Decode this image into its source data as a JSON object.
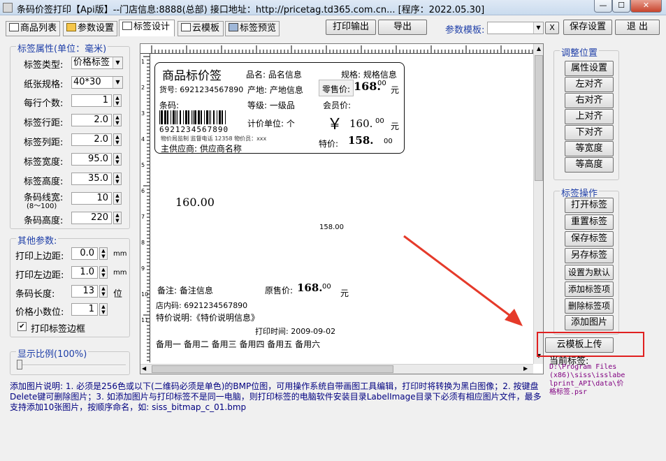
{
  "window": {
    "title": "条码价签打印【Api版】--门店信息:8888(总部) 接口地址：http://pricetag.td365.com.cn... [程序：2022.05.30]",
    "close_label": "✕",
    "min_label": "—",
    "max_label": "☐"
  },
  "tabs": [
    {
      "label": "商品列表"
    },
    {
      "label": "参数设置"
    },
    {
      "label": "标签设计"
    },
    {
      "label": "云模板"
    },
    {
      "label": "标签预览"
    }
  ],
  "toolbar": {
    "print_label": "打印输出",
    "export_label": "导出",
    "template_label": "参数模板:",
    "template_value": "",
    "clear_label": "X",
    "save_label": "保存设置",
    "exit_label": "退 出"
  },
  "label_props": {
    "title": "标签属性(单位：毫米)",
    "type_label": "标签类型:",
    "type_value": "价格标签",
    "size_label": "纸张规格:",
    "size_value": "40*30",
    "per_row_label": "每行个数:",
    "per_row_value": "1",
    "row_gap_label": "标签行距:",
    "row_gap_value": "2.0",
    "col_gap_label": "标签列距:",
    "col_gap_value": "2.0",
    "width_label": "标签宽度:",
    "width_value": "95.0",
    "height_label": "标签高度:",
    "height_value": "35.0",
    "line_width_label": "条码线宽:",
    "line_width_sub": "(8～100)",
    "line_width_value": "10",
    "barcode_height_label": "条码高度:",
    "barcode_height_value": "220"
  },
  "other_params": {
    "title": "其他参数:",
    "top_margin_label": "打印上边距:",
    "top_margin_value": "0.0",
    "top_margin_unit": "mm",
    "left_margin_label": "打印左边距:",
    "left_margin_value": "1.0",
    "left_margin_unit": "mm",
    "barcode_len_label": "条码长度:",
    "barcode_len_value": "13",
    "barcode_len_unit": "位",
    "decimal_label": "价格小数位:",
    "decimal_value": "1",
    "border_label": "打印标签边框",
    "border_checked": "✔"
  },
  "zoom": {
    "title": "显示比例(100%)"
  },
  "canvas": {
    "title": "商品标价签",
    "name_label": "品名:",
    "name_value": "品名信息",
    "spec_label": "规格:",
    "spec_value": "规格信息",
    "sku_label": "货号:",
    "sku_value": "6921234567890",
    "origin_label": "产地:",
    "origin_value": "产地信息",
    "retail_label": "零售价:",
    "retail_price": "168.",
    "retail_cents": "00",
    "retail_unit": "元",
    "barcode_label": "条码:",
    "grade_label": "等级:",
    "grade_value": "一级品",
    "member_label": "会员价:",
    "barcode_digits": "6921234567890",
    "unit_label": "计价单位:",
    "unit_value": "个",
    "yen_sign": "￥",
    "yen_price": "160.",
    "yen_cents": "00",
    "yen_unit": "元",
    "footer_small": "物价局监制  监督电话 12358  物价员：xxx",
    "special_label": "特价:",
    "special_price": "158.",
    "special_cents": "00",
    "supplier_label": "主供应商:",
    "supplier_value": "供应商名称",
    "float_price_1": "160.00",
    "float_price_2": "158.00",
    "remark_label": "备注:",
    "remark_value": "备注信息",
    "orig_label": "原售价:",
    "orig_price": "168.",
    "orig_cents": "00",
    "orig_unit": "元",
    "store_code": "店内码: 6921234567890",
    "special_desc": "特价说明:《特价说明信息》",
    "print_time": "打印时间: 2009-09-02",
    "reserves": "备用一  备用二  备用三  备用四  备用五  备用六",
    "ruler_v_labels": [
      "1",
      "2",
      "3",
      "4",
      "5",
      "6",
      "7",
      "8",
      "9",
      "10",
      "11"
    ]
  },
  "adjust": {
    "title": "调整位置",
    "buttons": [
      "属性设置",
      "左对齐",
      "右对齐",
      "上对齐",
      "下对齐",
      "等宽度",
      "等高度"
    ]
  },
  "label_ops": {
    "title": "标签操作",
    "buttons": [
      "打开标签",
      "重置标签",
      "保存标签",
      "另存标签",
      "设置为默认",
      "添加标签项",
      "删除标签项",
      "添加图片"
    ],
    "cloud_upload": "云模板上传",
    "current_label": "当前标签:",
    "current_path": "D:\\Program Files (x86)\\siss\\isslabelprint_API\\data\\价格标签.psr"
  },
  "help_text": "添加图片说明: 1. 必须是256色或以下(二维码必须是单色)的BMP位图，可用操作系统自带画图工具编辑，打印时将转换为黑白图像；2. 按键盘Delete键可删除图片；3. 如添加图片与打印标签不是同一电脑，则打印标签的电脑软件安装目录LabelImage目录下必须有相应图片文件，最多支持添加10张图片，按顺序命名，如: siss_bitmap_c_01.bmp",
  "colors": {
    "highlight_box": "#e02020",
    "arrow": "#e53a2a",
    "legend_blue": "#1f3fa8",
    "help_navy": "#000080",
    "path_purple": "#800080"
  }
}
